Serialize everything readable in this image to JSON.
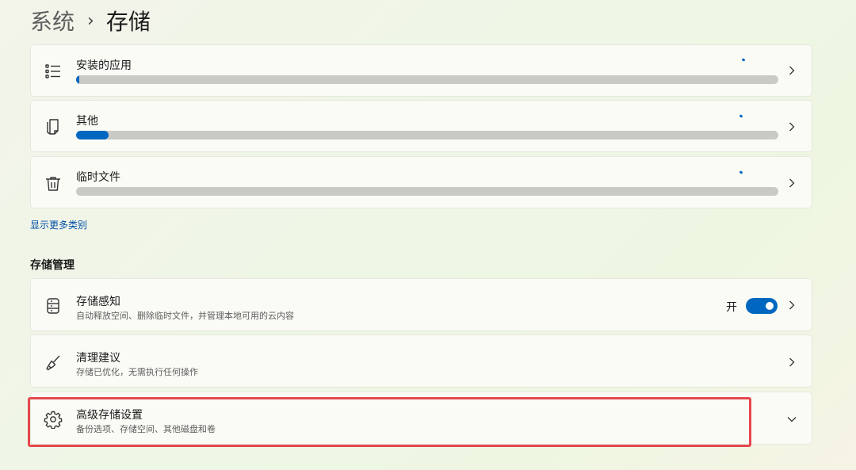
{
  "breadcrumb": {
    "parent": "系统",
    "separator": "›",
    "current": "存储"
  },
  "categories": [
    {
      "label": "安装的应用",
      "icon": "list-icon",
      "usage_fraction": 0.004
    },
    {
      "label": "其他",
      "icon": "document-stack-icon",
      "usage_fraction": 0.046
    },
    {
      "label": "临时文件",
      "icon": "trash-icon",
      "usage_fraction": 0.0
    }
  ],
  "show_more_link": "显示更多类别",
  "management": {
    "header": "存储管理",
    "storage_sense": {
      "title": "存储感知",
      "subtitle": "自动释放空间、删除临时文件，并管理本地可用的云内容",
      "toggle_label": "开",
      "toggle_on": true,
      "icon": "storage-drive-icon"
    },
    "cleanup": {
      "title": "清理建议",
      "subtitle": "存储已优化，无需执行任何操作",
      "icon": "broom-icon"
    },
    "advanced": {
      "title": "高级存储设置",
      "subtitle": "备份选项、存储空间、其他磁盘和卷",
      "icon": "gear-icon"
    }
  },
  "colors": {
    "accent": "#0067c0",
    "highlight_border": "#e5484d",
    "bar_track": "#c9c9c6"
  }
}
